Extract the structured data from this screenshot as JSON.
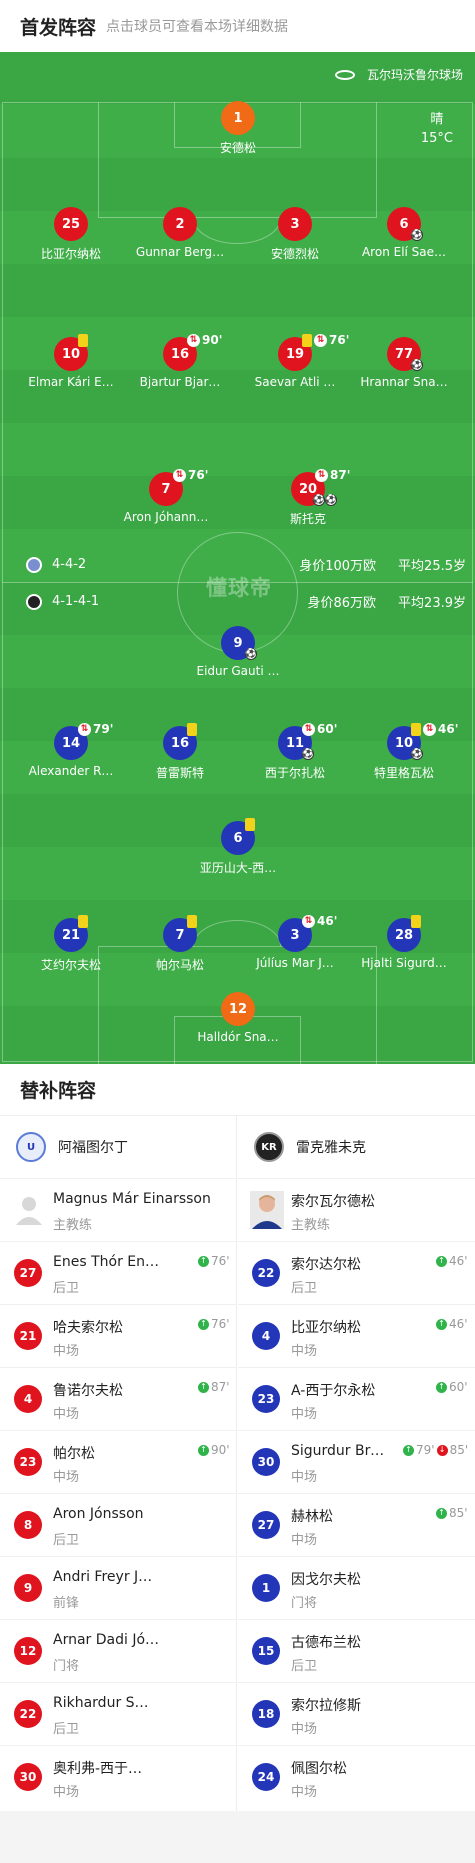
{
  "header": {
    "title": "首发阵容",
    "subtitle": "点击球员可查看本场详细数据"
  },
  "pitch": {
    "venue": "瓦尔玛沃鲁尔球场",
    "weather": {
      "condition": "晴",
      "temperature": "15°C"
    },
    "watermark": "懂球帝",
    "home_summary": {
      "formation": "4-4-2",
      "value": "身价100万欧",
      "avg_age": "平均25.5岁"
    },
    "away_summary": {
      "formation": "4-1-4-1",
      "value": "身价86万欧",
      "avg_age": "平均23.9岁"
    },
    "home_players": [
      {
        "num": "1",
        "name": "安德松"
      },
      {
        "num": "25",
        "name": "比亚尔纳松"
      },
      {
        "num": "2",
        "name": "Gunnar Berg…"
      },
      {
        "num": "3",
        "name": "安德烈松"
      },
      {
        "num": "6",
        "name": "Aron Elí Sae…"
      },
      {
        "num": "10",
        "name": "Elmar Kári E…"
      },
      {
        "num": "16",
        "name": "Bjartur Bjar…",
        "sub_min": "90'"
      },
      {
        "num": "19",
        "name": "Saevar Atli …",
        "sub_min": "76'"
      },
      {
        "num": "77",
        "name": "Hrannar Sna…"
      },
      {
        "num": "7",
        "name": "Aron Jóhann…",
        "sub_min": "76'"
      },
      {
        "num": "20",
        "name": "斯托克",
        "sub_min": "87'"
      }
    ],
    "away_players": [
      {
        "num": "9",
        "name": "Eidur Gauti …"
      },
      {
        "num": "14",
        "name": "Alexander R…",
        "sub_min": "79'"
      },
      {
        "num": "16",
        "name": "普雷斯特"
      },
      {
        "num": "11",
        "name": "西于尔扎松",
        "sub_min": "60'"
      },
      {
        "num": "10",
        "name": "特里格瓦松",
        "sub_min": "46'"
      },
      {
        "num": "6",
        "name": "亚历山大-西…"
      },
      {
        "num": "21",
        "name": "艾约尔夫松"
      },
      {
        "num": "7",
        "name": "帕尔马松"
      },
      {
        "num": "3",
        "name": "Júlíus Mar J…",
        "sub_min": "46'"
      },
      {
        "num": "28",
        "name": "Hjalti Sigurd…"
      },
      {
        "num": "12",
        "name": "Halldór Sna…"
      }
    ]
  },
  "subs": {
    "title": "替补阵容",
    "home": {
      "team": "阿福图尔丁",
      "coach": {
        "name": "Magnus Már Einarsson",
        "role": "主教练"
      },
      "players": [
        {
          "num": "27",
          "name": "Enes Thór En…",
          "pos": "后卫",
          "in": "76'"
        },
        {
          "num": "21",
          "name": "哈夫索尔松",
          "pos": "中场",
          "in": "76'"
        },
        {
          "num": "4",
          "name": "鲁诺尔夫松",
          "pos": "中场",
          "in": "87'"
        },
        {
          "num": "23",
          "name": "帕尔松",
          "pos": "中场",
          "in": "90'"
        },
        {
          "num": "8",
          "name": "Aron Jónsson",
          "pos": "后卫"
        },
        {
          "num": "9",
          "name": "Andri Freyr J…",
          "pos": "前锋"
        },
        {
          "num": "12",
          "name": "Arnar Dadi Jó…",
          "pos": "门将"
        },
        {
          "num": "22",
          "name": "Rikhardur Sm…",
          "pos": "后卫"
        },
        {
          "num": "30",
          "name": "奥利弗-西于…",
          "pos": "中场"
        }
      ]
    },
    "away": {
      "team": "雷克雅未克",
      "coach": {
        "name": "索尔瓦尔德松",
        "role": "主教练"
      },
      "players": [
        {
          "num": "22",
          "name": "索尔达尔松",
          "pos": "后卫",
          "in": "46'"
        },
        {
          "num": "4",
          "name": "比亚尔纳松",
          "pos": "中场",
          "in": "46'"
        },
        {
          "num": "23",
          "name": "A-西于尔永松",
          "pos": "中场",
          "in": "60'"
        },
        {
          "num": "30",
          "name": "Sigurdur Brek…",
          "pos": "中场",
          "in": "79'",
          "out": "85'"
        },
        {
          "num": "27",
          "name": "赫林松",
          "pos": "中场",
          "in": "85'"
        },
        {
          "num": "1",
          "name": "因戈尔夫松",
          "pos": "门将"
        },
        {
          "num": "15",
          "name": "古德布兰松",
          "pos": "后卫"
        },
        {
          "num": "18",
          "name": "索尔拉修斯",
          "pos": "中场"
        },
        {
          "num": "24",
          "name": "佩图尔松",
          "pos": "中场"
        }
      ]
    }
  },
  "colors": {
    "home": "#e0141e",
    "away": "#2436b8",
    "goalkeeper": "#f16a16",
    "pitch": "#3fae49",
    "sub_in": "#2fb34a"
  },
  "icons": {
    "venue": "stadium-icon",
    "goal": "football-icon",
    "yellow": "yellow-card-icon",
    "sub": "substitution-icon"
  }
}
